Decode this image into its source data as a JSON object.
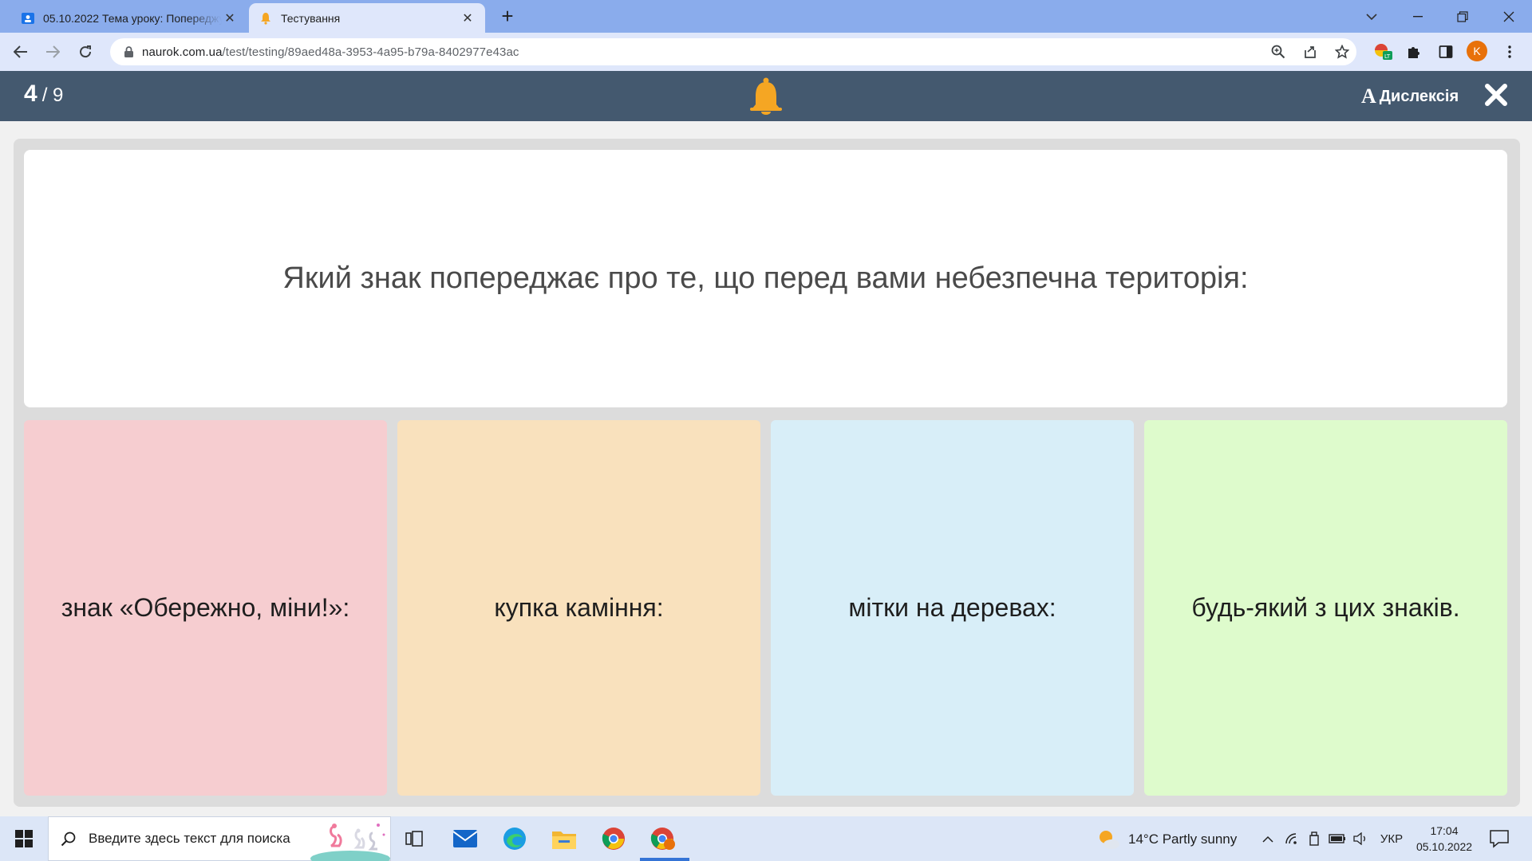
{
  "browser": {
    "tabs": [
      {
        "title": "05.10.2022 Тема уроку: Попереджу",
        "active": false
      },
      {
        "title": "Тестування",
        "active": true
      }
    ],
    "new_tab_label": "+",
    "url_host": "naurok.com.ua",
    "url_path": "/test/testing/89aed48a-3953-4a95-b79a-8402977e43ac",
    "profile_initial": "K",
    "accent_color": "#8aacec"
  },
  "app": {
    "progress_current": "4",
    "progress_total": "/ 9",
    "dyslexia_icon": "A",
    "dyslexia_label": "Дислексія",
    "header_color": "#44596f"
  },
  "question": {
    "text": "Який знак попереджає про те, що перед вами небезпечна територія:"
  },
  "answers": [
    {
      "text": "знак «Обережно, міни!»:",
      "color": "#f6cdd0"
    },
    {
      "text": "купка каміння:",
      "color": "#f9e1bd"
    },
    {
      "text": "мітки на деревах:",
      "color": "#d8eef8"
    },
    {
      "text": "будь-який з цих знаків.",
      "color": "#defbcc"
    }
  ],
  "taskbar": {
    "search_placeholder": "Введите здесь текст для поиска",
    "weather": "14°C  Partly sunny",
    "language": "УКР",
    "time": "17:04",
    "date": "05.10.2022"
  }
}
